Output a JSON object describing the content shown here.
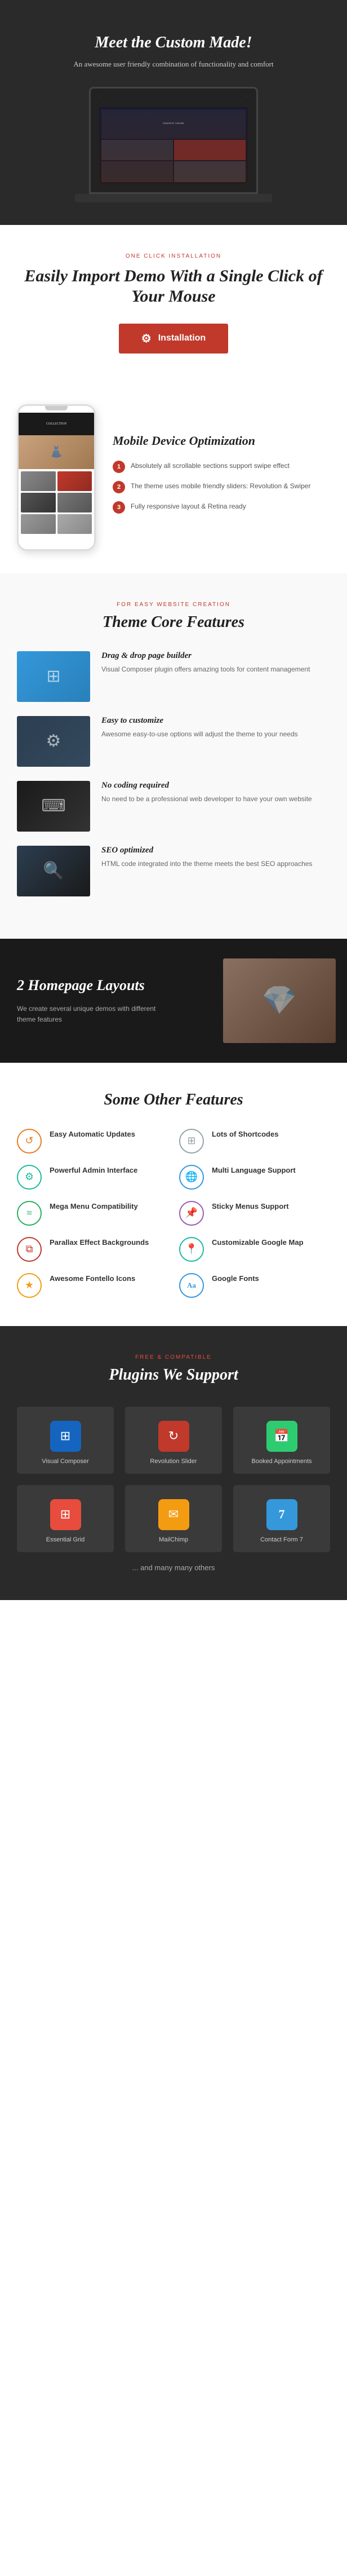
{
  "hero": {
    "title": "Meet the Custom Made!",
    "subtitle": "An awesome user friendly combination\nof functionality and comfort"
  },
  "installation": {
    "eyebrow": "ONE CLICK INSTALLATION",
    "title": "Easily Import Demo With a Single Click of Your Mouse",
    "button_label": "Installation"
  },
  "mobile": {
    "title": "Mobile Device Optimization",
    "features": [
      "Absolutely all scrollable sections support swipe effect",
      "The theme uses mobile friendly sliders: Revolution & Swiper",
      "Fully responsive layout & Retina ready"
    ]
  },
  "core_features": {
    "eyebrow": "FOR EASY WEBSITE CREATION",
    "title": "Theme Core Features",
    "items": [
      {
        "title": "Drag & drop page builder",
        "text": "Visual Composer plugin offers amazing tools for content management"
      },
      {
        "title": "Easy to customize",
        "text": "Awesome easy-to-use options will adjust the theme to your needs"
      },
      {
        "title": "No coding required",
        "text": "No need to be a professional web developer to have your own website"
      },
      {
        "title": "SEO optimized",
        "text": "HTML code integrated into the theme meets the best SEO approaches"
      }
    ]
  },
  "layouts": {
    "title": "2 Homepage Layouts",
    "text": "We create several unique demos with different theme features"
  },
  "other_features": {
    "title": "Some Other Features",
    "items": [
      {
        "label": "Easy Automatic Updates",
        "icon": "↺",
        "color": "orange"
      },
      {
        "label": "Lots of Shortcodes",
        "icon": "⊞",
        "color": "gray"
      },
      {
        "label": "Powerful Admin Interface",
        "icon": "⚙",
        "color": "teal"
      },
      {
        "label": "Multi Language Support",
        "icon": "🌐",
        "color": "blue"
      },
      {
        "label": "Mega Menu Compatibility",
        "icon": "≡",
        "color": "green"
      },
      {
        "label": "Sticky Menus Support",
        "icon": "📌",
        "color": "purple"
      },
      {
        "label": "Parallax Effect Backgrounds",
        "icon": "⧉",
        "color": "red"
      },
      {
        "label": "Customizable Google Map",
        "icon": "📍",
        "color": "teal"
      },
      {
        "label": "Awesome Fontello Icons",
        "icon": "★",
        "color": "yellow"
      },
      {
        "label": "Google Fonts",
        "icon": "Aa",
        "color": "blue"
      }
    ]
  },
  "plugins": {
    "eyebrow": "FREE & COMPATIBLE",
    "title": "Plugins We Support",
    "items": [
      {
        "name": "Visual Composer",
        "icon": "⊞",
        "color_class": "pi-vc"
      },
      {
        "name": "Revolution Slider",
        "icon": "↻",
        "color_class": "pi-rs"
      },
      {
        "name": "Booked Appointments",
        "icon": "📅",
        "color_class": "pi-ba"
      },
      {
        "name": "Essential Grid",
        "icon": "⊞",
        "color_class": "pi-eg"
      },
      {
        "name": "MailChimp",
        "icon": "✉",
        "color_class": "pi-mc"
      },
      {
        "name": "Contact Form 7",
        "icon": "7",
        "color_class": "pi-cf"
      }
    ],
    "more_text": "... and many many others"
  }
}
